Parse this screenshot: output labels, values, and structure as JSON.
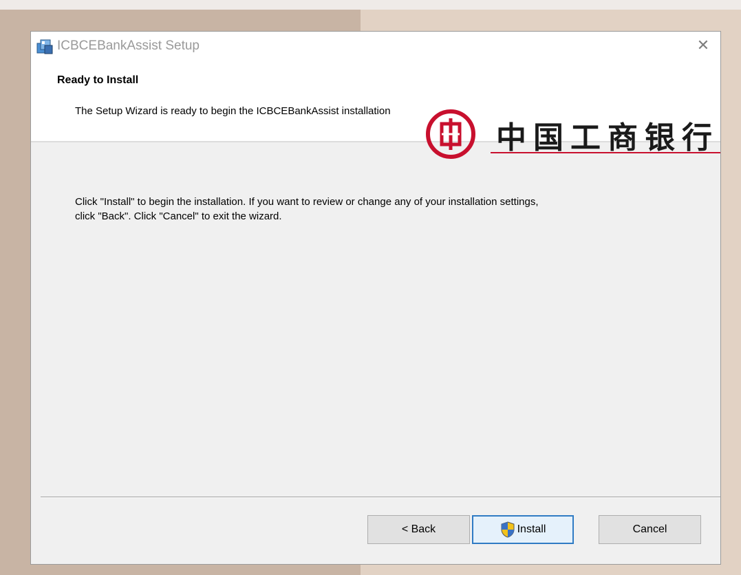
{
  "window": {
    "title": "ICBCEBankAssist Setup",
    "close_icon": "close-icon"
  },
  "banner": {
    "heading": "Ready to Install",
    "description": "The Setup Wizard is ready to begin the ICBCEBankAssist installation",
    "logo_text": "中国工商银行",
    "logo_color": "#c8102e"
  },
  "body": {
    "line1": "Click \"Install\" to begin the installation.  If you want to review or change any of your installation settings,",
    "line2": "click \"Back\".  Click \"Cancel\" to exit the wizard."
  },
  "buttons": {
    "back": "< Back",
    "install": "Install",
    "cancel": "Cancel",
    "install_icon": "uac-shield-icon"
  }
}
